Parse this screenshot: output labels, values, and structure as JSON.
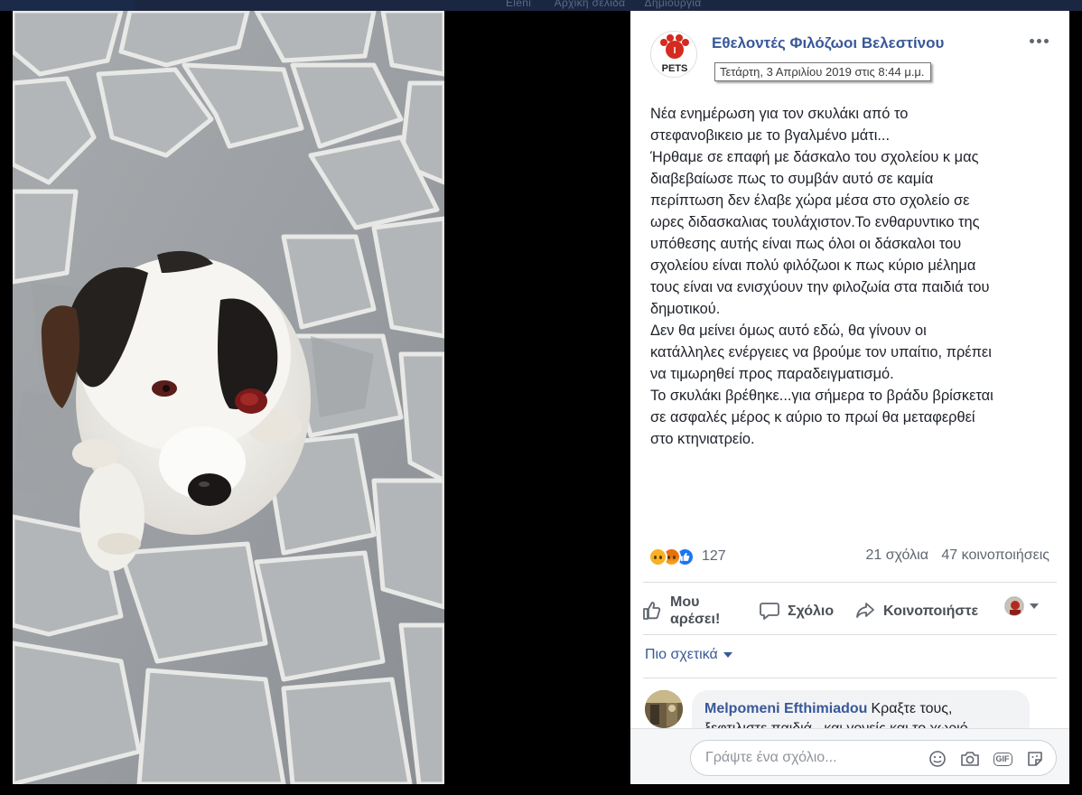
{
  "header": {
    "nav_items": [
      "Eleni",
      "Αρχική σελίδα",
      "Δημιουργία"
    ]
  },
  "post": {
    "page_name": "Εθελοντές Φιλόζωοι Βελεστίνου",
    "avatar_text": "PETS",
    "avatar_letter": "I",
    "timestamp_tooltip": "Τετάρτη, 3 Απριλίου 2019 στις 8:44 μ.μ.",
    "paragraphs": [
      "Νέα ενημέρωση για τον σκυλάκι από το\nστεφανοβικειο με το βγαλμένο μάτι...",
      "Ήρθαμε σε επαφή με δάσκαλο του σχολείου κ μας\nδιαβεβαίωσε πως το συμβάν αυτό σε καμία\nπερίπτωση δεν έλαβε χώρα μέσα στο σχολείο σε\nωρες διδασκαλιας τουλάχιστον.Το ενθαρυντικο της\nυπόθεσης αυτής είναι πως όλοι οι δάσκαλοι του\nσχολείου είναι πολύ φιλόζωοι κ πως κύριο μέλημα\nτους είναι να ενισχύουν την φιλοζωία στα παιδιά του\nδημοτικού.",
      "Δεν θα μείνει όμως αυτό εδώ, θα γίνουν οι\nκατάλληλες ενέργειες να βρούμε τον υπαίτιο, πρέπει\nνα τιμωρηθεί προς παραδειγματισμό.",
      "Το σκυλάκι βρέθηκε...για σήμερα το βράδυ βρίσκεται\nσε ασφαλές μέρος κ αύριο το πρωί θα μεταφερθεί\nστο κτηνιατρείο."
    ],
    "reaction_icons": [
      "sad-reaction-icon",
      "angry-reaction-icon",
      "like-reaction-icon"
    ],
    "reaction_count": "127",
    "comments_count": "21 σχόλια",
    "shares_count": "47 κοινοποιήσεις"
  },
  "actions": {
    "like_line1": "Μου",
    "like_line2": "αρέσει!",
    "comment": "Σχόλιο",
    "share": "Κοινοποιήστε"
  },
  "sort": {
    "label": "Πιο σχετικά"
  },
  "comments": [
    {
      "author": "Melpomeni Efthimiadou",
      "text": "Κραξτε τους, ξεφτιλιστε παιδιά...και γονείς και το χωριό"
    }
  ],
  "composer": {
    "placeholder": "Γράψτε ένα σχόλιο...",
    "icons": [
      "emoji-icon",
      "camera-icon",
      "gif-icon",
      "sticker-icon"
    ]
  },
  "colors": {
    "link_blue": "#385898",
    "like_blue": "#1877f2",
    "reaction_yellow": "#f7b125",
    "backdrop": "#000000"
  }
}
